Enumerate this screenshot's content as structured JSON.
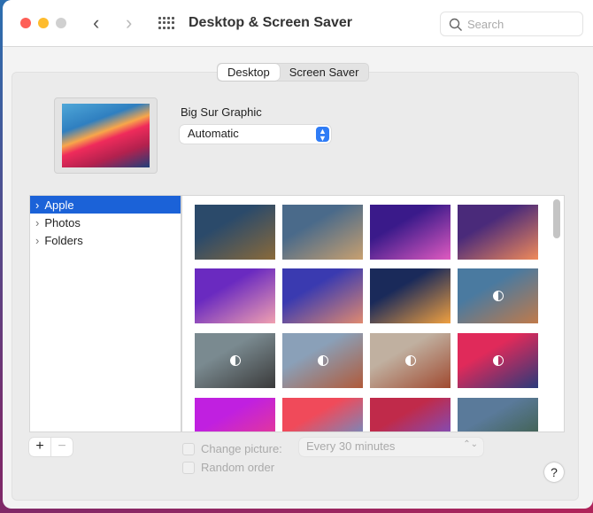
{
  "window": {
    "title": "Desktop & Screen Saver",
    "search_placeholder": "Search"
  },
  "tabs": [
    {
      "label": "Desktop",
      "active": true
    },
    {
      "label": "Screen Saver",
      "active": false
    }
  ],
  "wallpaper": {
    "name": "Big Sur Graphic",
    "mode": "Automatic"
  },
  "sources": [
    {
      "label": "Apple",
      "selected": true
    },
    {
      "label": "Photos",
      "selected": false
    },
    {
      "label": "Folders",
      "selected": false
    }
  ],
  "thumbnails": [
    {
      "name": "catalina-1",
      "colors": [
        "#2b4a6a",
        "#8a6a3a"
      ],
      "dynamic": false
    },
    {
      "name": "catalina-2",
      "colors": [
        "#4a6a8a",
        "#c8a070"
      ],
      "dynamic": false
    },
    {
      "name": "catalina-purple",
      "colors": [
        "#3a1a8a",
        "#e05ac0"
      ],
      "dynamic": false
    },
    {
      "name": "catalina-sunset",
      "colors": [
        "#4a2a7a",
        "#f08a5a"
      ],
      "dynamic": false
    },
    {
      "name": "mojave-purple",
      "colors": [
        "#6a2ac0",
        "#f0a0b0"
      ],
      "dynamic": false
    },
    {
      "name": "mojave-coast",
      "colors": [
        "#3a3ab0",
        "#e08a70"
      ],
      "dynamic": false
    },
    {
      "name": "gradient-blue",
      "colors": [
        "#1a2a5a",
        "#f0a040"
      ],
      "dynamic": false
    },
    {
      "name": "desert-rock",
      "colors": [
        "#4a7aa0",
        "#c07a4a"
      ],
      "dynamic": true
    },
    {
      "name": "rock-dark",
      "colors": [
        "#7a8a90",
        "#3a3a3a"
      ],
      "dynamic": true
    },
    {
      "name": "white-rock",
      "colors": [
        "#8aa0b8",
        "#b05a3a"
      ],
      "dynamic": true
    },
    {
      "name": "red-rock",
      "colors": [
        "#c0b0a0",
        "#a04a30"
      ],
      "dynamic": true
    },
    {
      "name": "big-sur-graphic",
      "colors": [
        "#e02a5a",
        "#2a3a7a"
      ],
      "dynamic": true
    },
    {
      "name": "neon",
      "colors": [
        "#c020e0",
        "#f04080"
      ],
      "dynamic": false
    },
    {
      "name": "big-sur-red",
      "colors": [
        "#f04a5a",
        "#4aa0e0"
      ],
      "dynamic": false
    },
    {
      "name": "big-sur-dark",
      "colors": [
        "#c02a4a",
        "#6a5ae0"
      ],
      "dynamic": false
    },
    {
      "name": "big-sur-coast",
      "colors": [
        "#5a7a9a",
        "#3a5a3a"
      ],
      "dynamic": false
    }
  ],
  "options": {
    "change_picture": "Change picture:",
    "interval": "Every 30 minutes",
    "random_order": "Random order"
  },
  "buttons": {
    "add": "+",
    "remove": "−",
    "help": "?"
  }
}
